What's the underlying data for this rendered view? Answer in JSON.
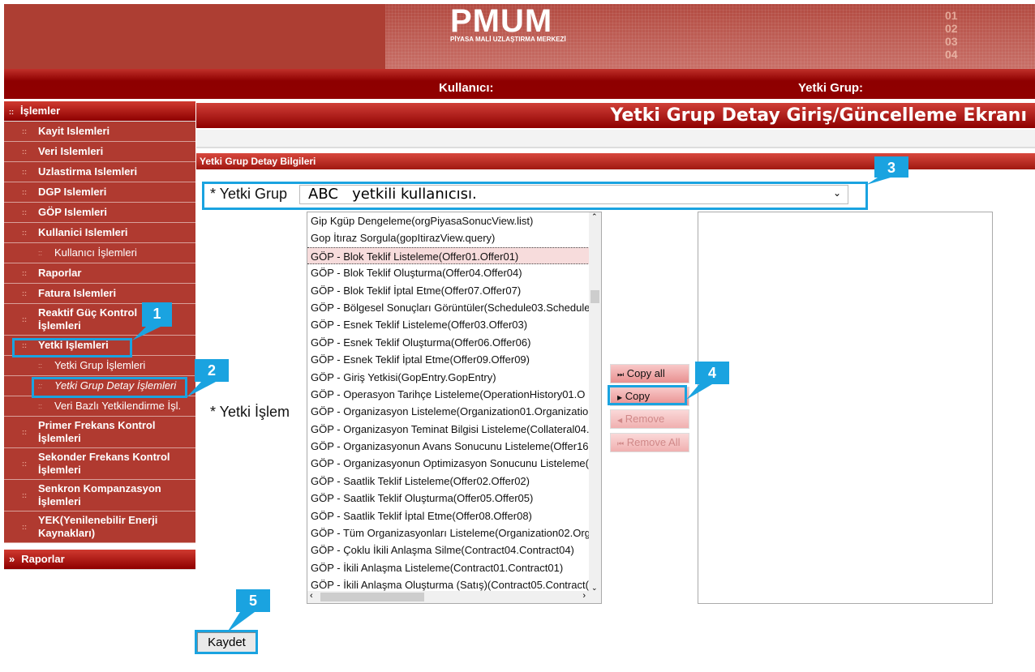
{
  "header": {
    "logo": "PMUM",
    "logo_sub": "PİYASA MALİ UZLAŞTIRMA MERKEZİ",
    "user_label": "Kullanıcı:",
    "group_label": "Yetki Grup:"
  },
  "sidebar": {
    "header": "İşlemler",
    "items": [
      {
        "label": "Kayit Islemleri",
        "level": 1
      },
      {
        "label": "Veri Islemleri",
        "level": 1
      },
      {
        "label": "Uzlastirma Islemleri",
        "level": 1
      },
      {
        "label": "DGP Islemleri",
        "level": 1
      },
      {
        "label": "GÖP Islemleri",
        "level": 1
      },
      {
        "label": "Kullanici Islemleri",
        "level": 1
      },
      {
        "label": "Kullanıcı İşlemleri",
        "level": 2
      },
      {
        "label": "Raporlar",
        "level": 1
      },
      {
        "label": "Fatura Islemleri",
        "level": 1
      },
      {
        "label": "Reaktif Güç Kontrol İşlemleri",
        "level": 1
      },
      {
        "label": "Yetki İşlemleri",
        "level": 1
      },
      {
        "label": "Yetki Grup İşlemleri",
        "level": 2
      },
      {
        "label": "Yetki Grup Detay İşlemleri",
        "level": 2,
        "active": true
      },
      {
        "label": "Veri Bazlı Yetkilendirme İşl.",
        "level": 2
      },
      {
        "label": "Primer Frekans Kontrol İşlemleri",
        "level": 1
      },
      {
        "label": "Sekonder Frekans Kontrol İşlemleri",
        "level": 1
      },
      {
        "label": "Senkron Kompanzasyon İşlemleri",
        "level": 1
      },
      {
        "label": "YEK(Yenilenebilir Enerji Kaynakları)",
        "level": 1
      }
    ],
    "footer": "Raporlar"
  },
  "main": {
    "title": "Yetki Grup Detay Giriş/Güncelleme Ekranı",
    "section": "Yetki Grup Detay Bilgileri",
    "group_label": "* Yetki Grup",
    "group_value": "ABC   yetkili kullanıcısı.",
    "perm_label": "* Yetki İşlem",
    "available": [
      "Gip Kgüp Dengeleme(orgPiyasaSonucView.list)",
      "Gop İtıraz Sorgula(gopItirazView.query)",
      "GÖP - Blok Teklif Listeleme(Offer01.Offer01)",
      "GÖP - Blok Teklif Oluşturma(Offer04.Offer04)",
      "GÖP - Blok Teklif İptal Etme(Offer07.Offer07)",
      "GÖP - Bölgesel Sonuçları Görüntüler(Schedule03.Schedule",
      "GÖP - Esnek Teklif Listeleme(Offer03.Offer03)",
      "GÖP - Esnek Teklif Oluşturma(Offer06.Offer06)",
      "GÖP - Esnek Teklif İptal Etme(Offer09.Offer09)",
      "GÖP - Giriş Yetkisi(GopEntry.GopEntry)",
      "GÖP - Operasyon Tarihçe Listeleme(OperationHistory01.O",
      "GÖP - Organizasyon Listeleme(Organization01.Organizatio",
      "GÖP - Organizasyon Teminat Bilgisi Listeleme(Collateral04.",
      "GÖP - Organizasyonun Avans Sonucunu Listeleme(Offer16",
      "GÖP - Organizasyonun Optimizasyon Sonucunu Listeleme(",
      "GÖP - Saatlik Teklif Listeleme(Offer02.Offer02)",
      "GÖP - Saatlik Teklif Oluşturma(Offer05.Offer05)",
      "GÖP - Saatlik Teklif İptal Etme(Offer08.Offer08)",
      "GÖP - Tüm Organizasyonları Listeleme(Organization02.Org",
      "GÖP - Çoklu İkili Anlaşma Silme(Contract04.Contract04)",
      "GÖP - İkili Anlaşma Listeleme(Contract01.Contract01)",
      "GÖP - İkili Anlaşma Oluşturma (Satış)(Contract05.Contract("
    ],
    "highlighted_index": 2,
    "buttons": {
      "copy_all": "Copy all",
      "copy": "Copy",
      "remove": "Remove",
      "remove_all": "Remove All"
    },
    "save": "Kaydet"
  },
  "callouts": [
    "1",
    "2",
    "3",
    "4",
    "5"
  ],
  "colors": {
    "brand_red": "#8e0000",
    "callout": "#1aa3e0"
  }
}
